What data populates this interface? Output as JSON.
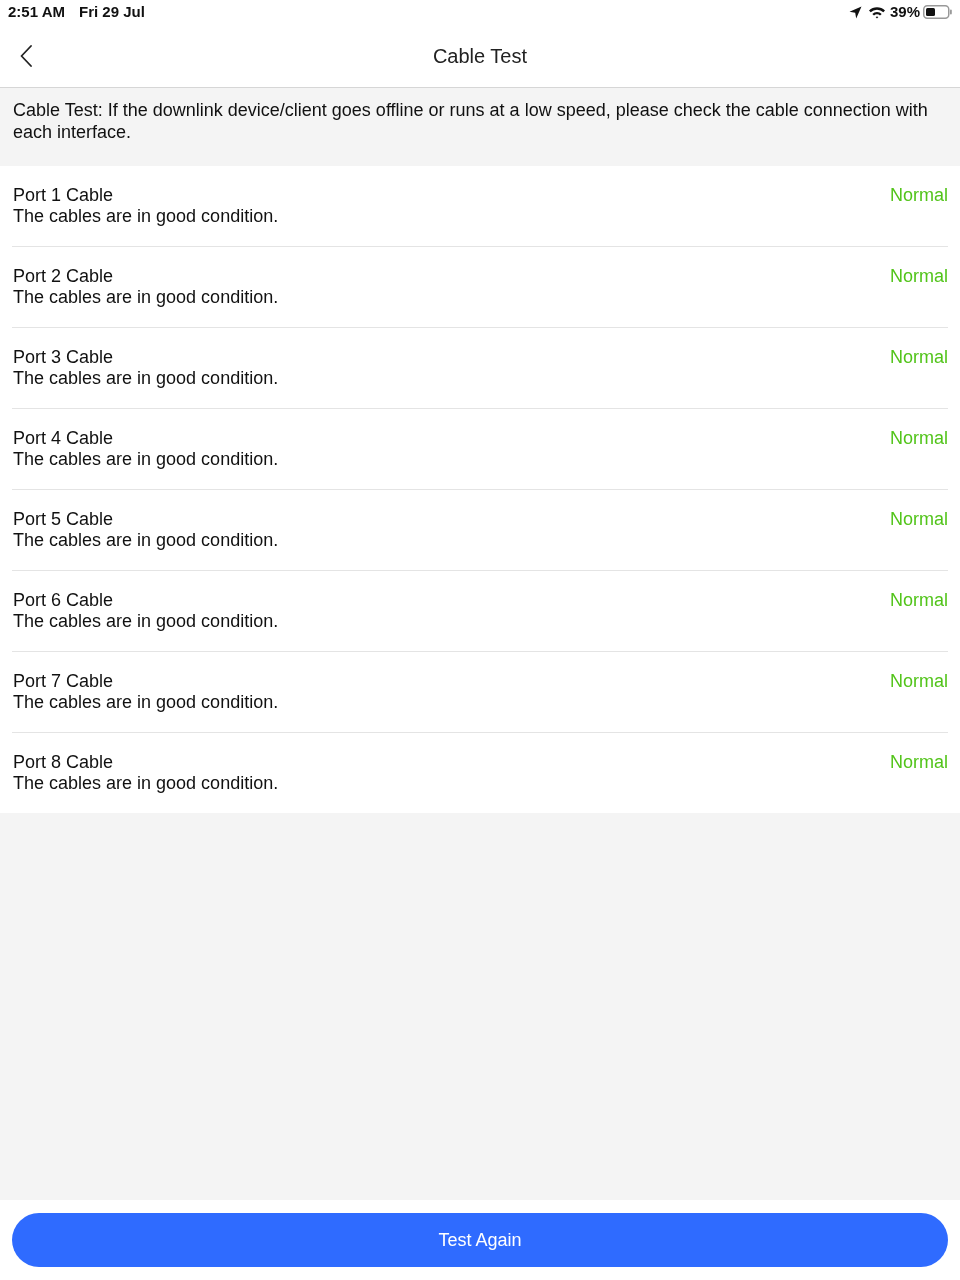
{
  "status_bar": {
    "time": "2:51 AM",
    "date": "Fri 29 Jul",
    "battery": "39%"
  },
  "header": {
    "title": "Cable Test"
  },
  "notice": "Cable Test: If the downlink device/client goes offline or runs at a low speed, please check the cable connection with each interface.",
  "ports": [
    {
      "name": "Port 1 Cable",
      "description": "The cables are in good condition.",
      "status": "Normal"
    },
    {
      "name": "Port 2 Cable",
      "description": "The cables are in good condition.",
      "status": "Normal"
    },
    {
      "name": "Port 3 Cable",
      "description": "The cables are in good condition.",
      "status": "Normal"
    },
    {
      "name": "Port 4 Cable",
      "description": "The cables are in good condition.",
      "status": "Normal"
    },
    {
      "name": "Port 5 Cable",
      "description": "The cables are in good condition.",
      "status": "Normal"
    },
    {
      "name": "Port 6 Cable",
      "description": "The cables are in good condition.",
      "status": "Normal"
    },
    {
      "name": "Port 7 Cable",
      "description": "The cables are in good condition.",
      "status": "Normal"
    },
    {
      "name": "Port 8 Cable",
      "description": "The cables are in good condition.",
      "status": "Normal"
    }
  ],
  "button": "Test Again"
}
